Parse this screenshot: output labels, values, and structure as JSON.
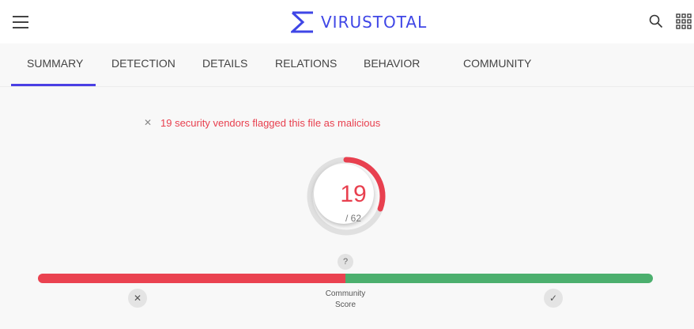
{
  "header": {
    "brand": "VIRUSTOTAL",
    "menu_icon": "hamburger-menu-icon",
    "search_icon": "search-icon",
    "apps_icon": "apps-grid-icon",
    "brand_color": "#3f46e6"
  },
  "tabs": [
    {
      "label": "SUMMARY",
      "active": true
    },
    {
      "label": "DETECTION"
    },
    {
      "label": "DETAILS"
    },
    {
      "label": "RELATIONS"
    },
    {
      "label": "BEHAVIOR"
    },
    {
      "label": "COMMUNITY"
    }
  ],
  "alert": {
    "icon": "close-icon",
    "message": "19 security vendors flagged this file as malicious",
    "color": "#e8404f"
  },
  "detection": {
    "count": "19",
    "total": "/ 62",
    "ratio": 0.306
  },
  "community": {
    "help": "?",
    "label_line1": "Community",
    "label_line2": "Score",
    "malicious_fraction": 0.5,
    "bad_color": "#ea4250",
    "good_color": "#4caf6e",
    "downvote_icon": "x-icon",
    "upvote_icon": "check-icon"
  }
}
